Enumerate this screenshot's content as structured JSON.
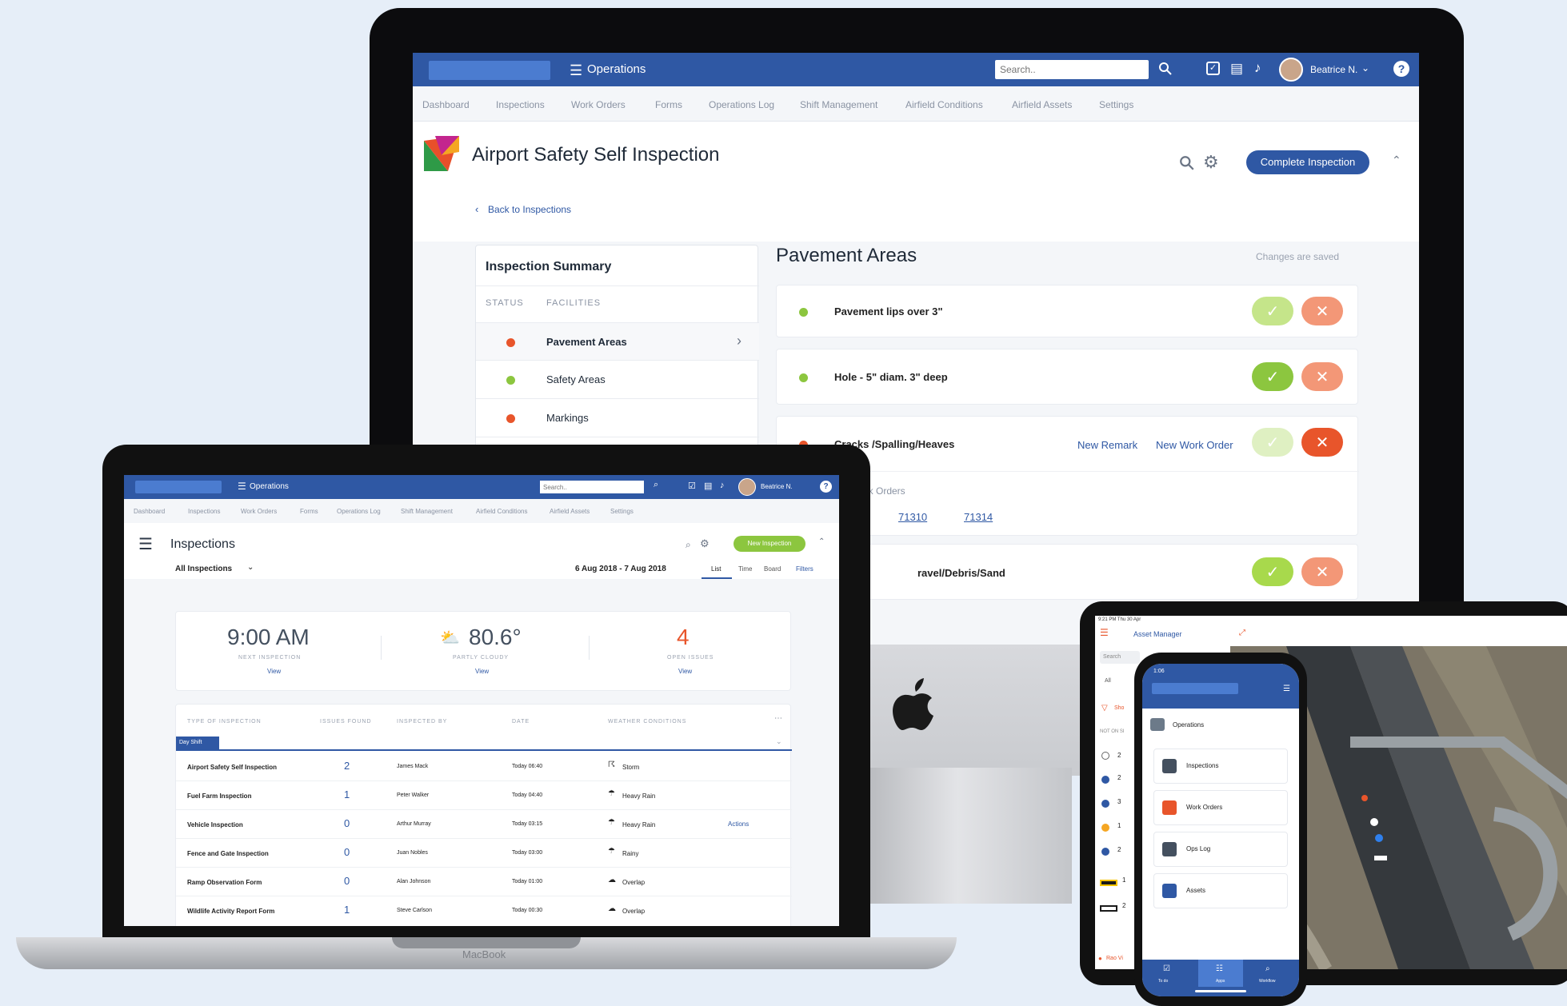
{
  "imac": {
    "app_title": "Operations",
    "search_placeholder": "Search..",
    "user_name": "Beatrice N.",
    "nav": [
      "Dashboard",
      "Inspections",
      "Work Orders",
      "Forms",
      "Operations Log",
      "Shift Management",
      "Airfield Conditions",
      "Airfield Assets",
      "Settings"
    ],
    "page_title": "Airport Safety Self Inspection",
    "complete_button": "Complete Inspection",
    "back_link": "Back to Inspections",
    "summary": {
      "title": "Inspection Summary",
      "col_status": "STATUS",
      "col_facilities": "FACILITIES",
      "items": [
        {
          "label": "Pavement Areas",
          "status_color": "#e8552b"
        },
        {
          "label": "Safety Areas",
          "status_color": "#8cc63f"
        },
        {
          "label": "Markings",
          "status_color": "#e8552b"
        }
      ]
    },
    "section_title": "Pavement Areas",
    "saved_text": "Changes are saved",
    "checks": [
      {
        "label": "Pavement lips over 3\"",
        "status_color": "#8cc63f"
      },
      {
        "label": "Hole - 5\" diam. 3\" deep",
        "status_color": "#8cc63f"
      },
      {
        "label": "Cracks /Spalling/Heaves",
        "status_color": "#e8552b"
      },
      {
        "label": "ravel/Debris/Sand",
        "status_color": "#8cc63f"
      }
    ],
    "new_remark": "New Remark",
    "new_work_order": "New Work Order",
    "work_orders_label": "ork Orders",
    "work_orders": [
      "71310",
      "71314"
    ]
  },
  "macbook": {
    "app_title": "Operations",
    "search_placeholder": "Search..",
    "user_name": "Beatrice N.",
    "nav": [
      "Dashboard",
      "Inspections",
      "Work Orders",
      "Forms",
      "Operations Log",
      "Shift Management",
      "Airfield Conditions",
      "Airfield Assets",
      "Settings"
    ],
    "page_title": "Inspections",
    "new_button": "New Inspection",
    "filter": "All Inspections",
    "date_range": "6 Aug 2018 - 7 Aug 2018",
    "views": [
      "List",
      "Time",
      "Board",
      "Filters"
    ],
    "stats": [
      {
        "value": "9:00 AM",
        "label": "NEXT INSPECTION",
        "link": "View"
      },
      {
        "value": "80.6°",
        "label": "PARTLY CLOUDY",
        "link": "View"
      },
      {
        "value": "4",
        "label": "OPEN ISSUES",
        "link": "View"
      }
    ],
    "table_headers": [
      "TYPE OF INSPECTION",
      "ISSUES FOUND",
      "INSPECTED BY",
      "DATE",
      "WEATHER CONDITIONS"
    ],
    "group": "Day Shift",
    "rows": [
      {
        "type": "Airport Safety Self Inspection",
        "issues": "2",
        "by": "James Mack",
        "date": "Today 06:40",
        "weather": "Storm"
      },
      {
        "type": "Fuel Farm Inspection",
        "issues": "1",
        "by": "Peter Walker",
        "date": "Today 04:40",
        "weather": "Heavy Rain"
      },
      {
        "type": "Vehicle Inspection",
        "issues": "0",
        "by": "Arthur Murray",
        "date": "Today 03:15",
        "weather": "Heavy Rain",
        "action": "Actions"
      },
      {
        "type": "Fence and Gate Inspection",
        "issues": "0",
        "by": "Juan Nobles",
        "date": "Today 03:00",
        "weather": "Rainy"
      },
      {
        "type": "Ramp Observation Form",
        "issues": "0",
        "by": "Alan Johnson",
        "date": "Today 01:00",
        "weather": "Overlap"
      },
      {
        "type": "Wildlife Activity Report Form",
        "issues": "1",
        "by": "Steve Carlson",
        "date": "Today 00:30",
        "weather": "Overlap"
      }
    ],
    "brand": "MacBook"
  },
  "ipad": {
    "status_time": "9:21 PM  Thu 30 Apr",
    "title": "Asset Manager",
    "search": "Search",
    "filter_all": "All",
    "filter_label": "Sho",
    "section": "NOT ON SI",
    "counts": [
      "2",
      "2",
      "3",
      "1",
      "2",
      "1",
      "2"
    ],
    "footer_text": "Rao Vi"
  },
  "iphone": {
    "time": "1:06",
    "menu": [
      "Operations",
      "Inspections",
      "Work Orders",
      "Ops Log",
      "Assets"
    ],
    "tabs": [
      "To do",
      "Apps",
      "Workflow"
    ]
  }
}
